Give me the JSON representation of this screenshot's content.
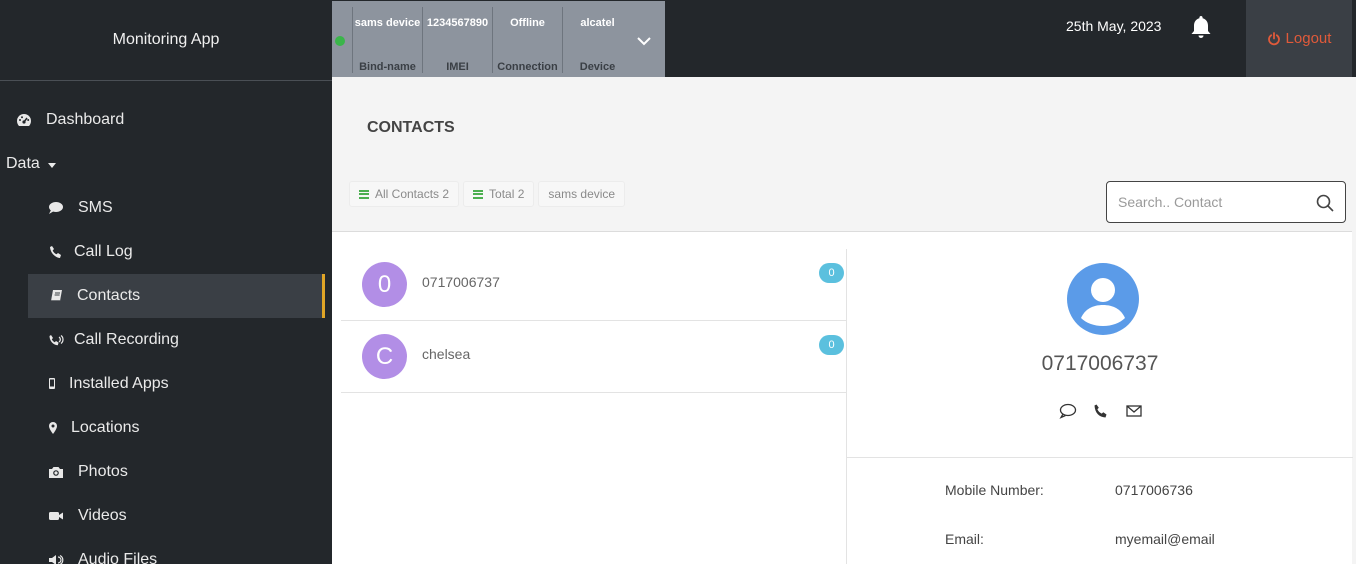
{
  "app": {
    "title": "Monitoring App"
  },
  "sidebar": {
    "dashboard": "Dashboard",
    "data_menu": "Data",
    "items": [
      {
        "label": "SMS",
        "icon": "comment-icon"
      },
      {
        "label": "Call Log",
        "icon": "phone-icon"
      },
      {
        "label": "Contacts",
        "icon": "book-icon",
        "active": true
      },
      {
        "label": "Call Recording",
        "icon": "phone-volume-icon"
      },
      {
        "label": "Installed Apps",
        "icon": "mobile-icon"
      },
      {
        "label": "Locations",
        "icon": "map-marker-icon"
      },
      {
        "label": "Photos",
        "icon": "camera-icon"
      },
      {
        "label": "Videos",
        "icon": "video-icon"
      },
      {
        "label": "Audio Files",
        "icon": "audio-icon"
      }
    ]
  },
  "device": {
    "status_color": "#3ab54a",
    "columns": [
      {
        "value": "sams device",
        "label": "Bind-name"
      },
      {
        "value": "1234567890",
        "label": "IMEI"
      },
      {
        "value": "Offline",
        "label": "Connection"
      },
      {
        "value": "alcatel",
        "label": "Device"
      }
    ]
  },
  "header": {
    "date": "25th May, 2023",
    "logout": "Logout"
  },
  "page": {
    "title": "CONTACTS",
    "chips": {
      "all": "All Contacts 2",
      "total": "Total 2",
      "device": "sams device"
    },
    "search_placeholder": "Search.. Contact"
  },
  "contacts": [
    {
      "initial": "0",
      "name": "0717006737",
      "badge": "0"
    },
    {
      "initial": "C",
      "name": "chelsea",
      "badge": "0"
    }
  ],
  "detail": {
    "name": "0717006737",
    "mobile_label": "Mobile Number:",
    "mobile_value": "0717006736",
    "email_label": "Email:",
    "email_value": "myemail@email"
  },
  "colors": {
    "accent": "#e0a526",
    "avatar": "#b28ee6",
    "badge": "#5bc0de",
    "logout": "#e05a3a",
    "profile": "#5b9be8"
  }
}
